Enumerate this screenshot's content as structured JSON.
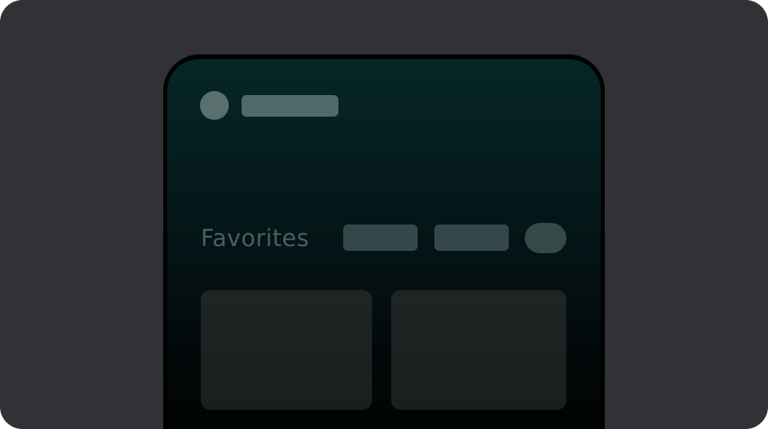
{
  "favorites": {
    "title": "Favorites"
  },
  "colors": {
    "frame_background": "#323236",
    "phone_bezel": "#000000",
    "screen_top": "#062627",
    "screen_bottom": "#010304",
    "placeholder": "#52696a",
    "chip": "#344849",
    "card": "#1f2424",
    "title_text": "#4a5f60"
  },
  "icons": [
    "avatar-placeholder"
  ]
}
